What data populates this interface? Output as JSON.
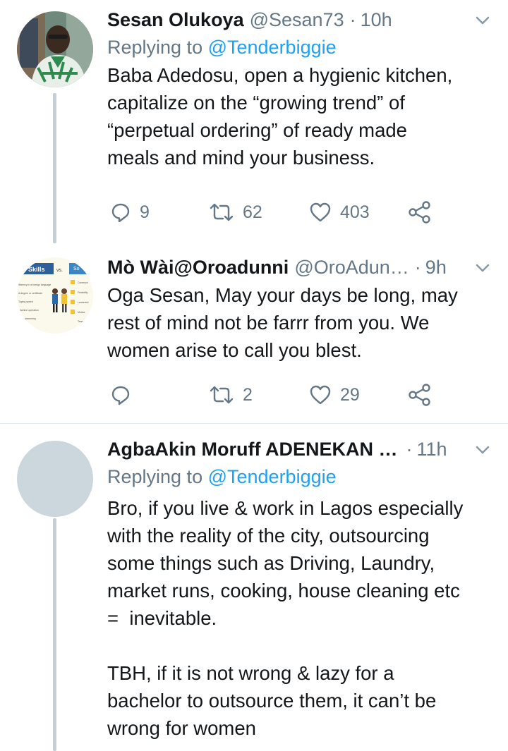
{
  "tweets": [
    {
      "name": "Sesan Olukoya",
      "handle": "@Sesan73",
      "separator": "·",
      "time": "10h",
      "replying_prefix": "Replying to ",
      "replying_to": "@Tenderbiggie",
      "text": "Baba Adedosu, open a hygienic kitchen,\ncapitalize on the “growing trend” of\n“perpetual ordering” of ready made\nmeals and mind your business.",
      "replies": "9",
      "retweets": "62",
      "likes": "403"
    },
    {
      "name": "Mò Wài@Oroadunni",
      "handle": "@OroAdun…",
      "separator": "·",
      "time": "9h",
      "text": "Oga Sesan, May your days be long, may\nrest of mind not be farrr from you. We\nwomen arise to call you blest.",
      "replies": "",
      "retweets": "2",
      "likes": "29"
    },
    {
      "name": "AgbaAkin Moruff ADENEKAN …",
      "handle": "",
      "separator": "·",
      "time": "11h",
      "replying_prefix": "Replying to ",
      "replying_to": "@Tenderbiggie",
      "text": "Bro, if you live & work in Lagos especially\nwith the reality of the city, outsourcing\nsome things such as Driving, Laundry,\nmarket runs, cooking, house cleaning etc\n=  inevitable.\n\nTBH, if it is not wrong & lazy for a\nbachelor to outsource them, it can’t be\nwrong for women"
    }
  ],
  "avatar2_text": {
    "title": "d Skills",
    "vs": "vs.",
    "right": "So",
    "l1": "fficiency in a foreign language",
    "l2": "A degree or certificate",
    "l3": "Typing speed",
    "l4": "Machine operation",
    "l5": "er programming",
    "r1": "Communi",
    "r2": "Flexibility",
    "r3": "Leadershi",
    "r4": "Motiva",
    "r5": "Teamw"
  },
  "colors": {
    "text": "#14171a",
    "muted": "#657786",
    "link": "#1da1f2",
    "thread_line": "#c4cfd6",
    "divider": "#e1e8ed"
  },
  "icons": [
    "reply-icon",
    "retweet-icon",
    "like-icon",
    "share-icon",
    "chevron-down-icon"
  ]
}
